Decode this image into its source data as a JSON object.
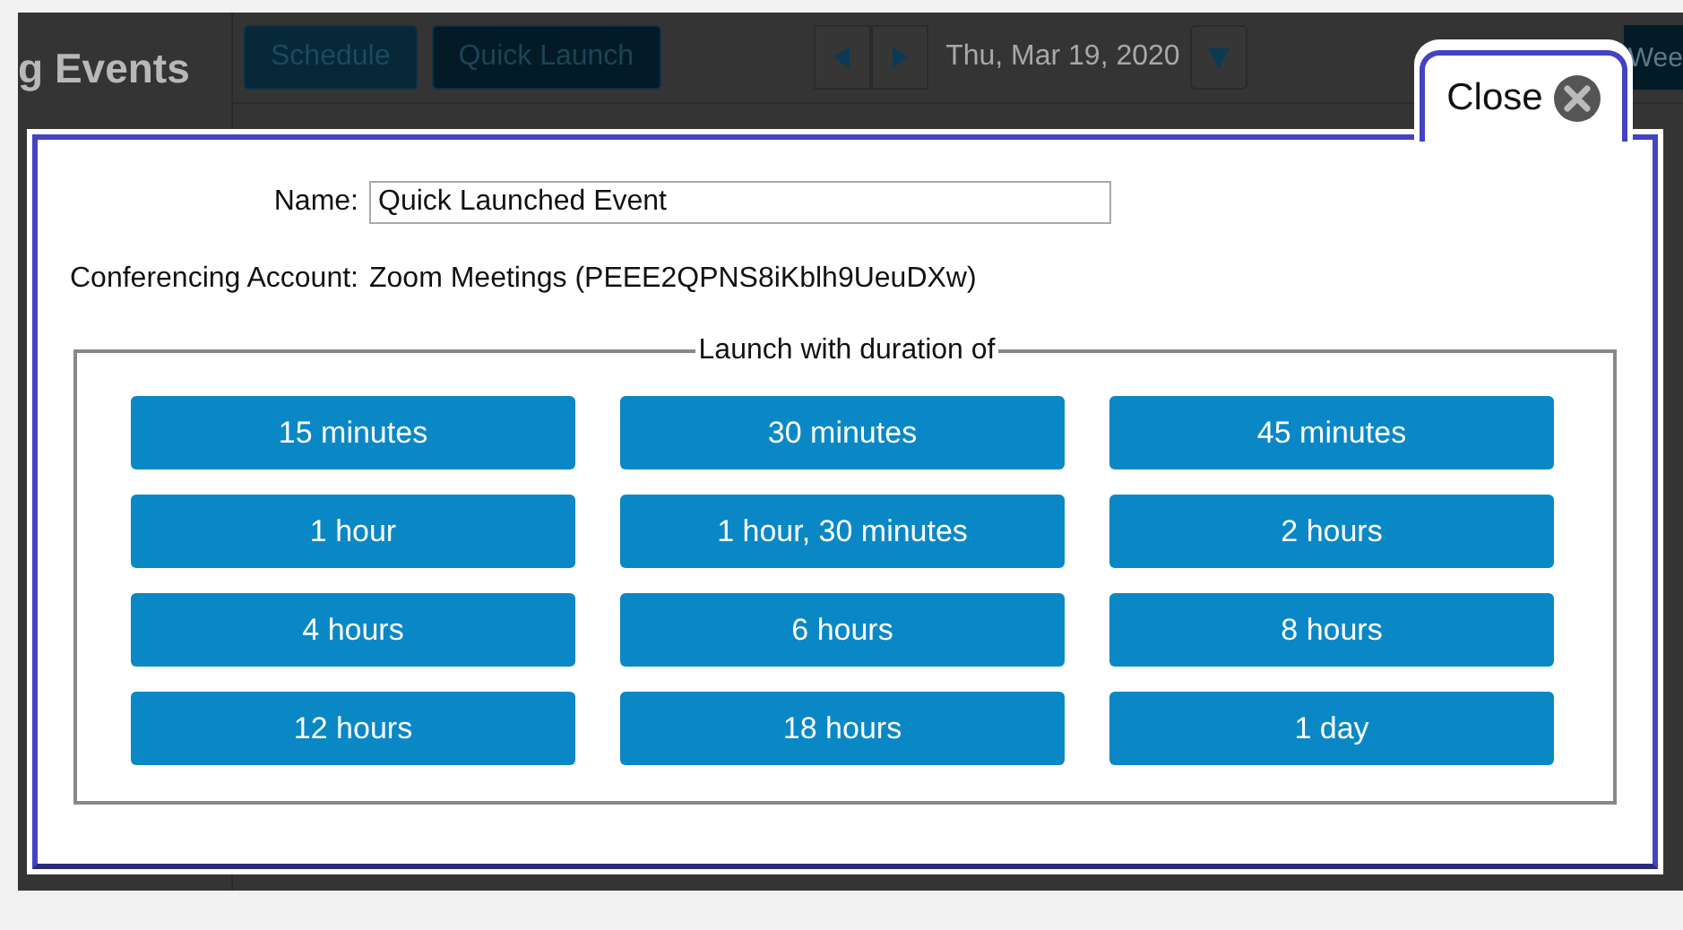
{
  "background": {
    "sidebar_title": "g Events",
    "buttons": [
      {
        "label": "Schedule",
        "selected": false
      },
      {
        "label": "Quick Launch",
        "selected": true
      }
    ],
    "date": "Thu, Mar 19, 2020",
    "view_button": "Wee"
  },
  "dialog": {
    "close_label": "Close",
    "name_label": "Name:",
    "name_value": "Quick Launched Event",
    "account_label": "Conferencing Account:",
    "account_value": "Zoom Meetings (PEEE2QPNS8iKblh9UeuDXw)",
    "duration_legend": "Launch with duration of",
    "durations": [
      "15 minutes",
      "30 minutes",
      "45 minutes",
      "1 hour",
      "1 hour, 30 minutes",
      "2 hours",
      "4 hours",
      "6 hours",
      "8 hours",
      "12 hours",
      "18 hours",
      "1 day"
    ]
  }
}
